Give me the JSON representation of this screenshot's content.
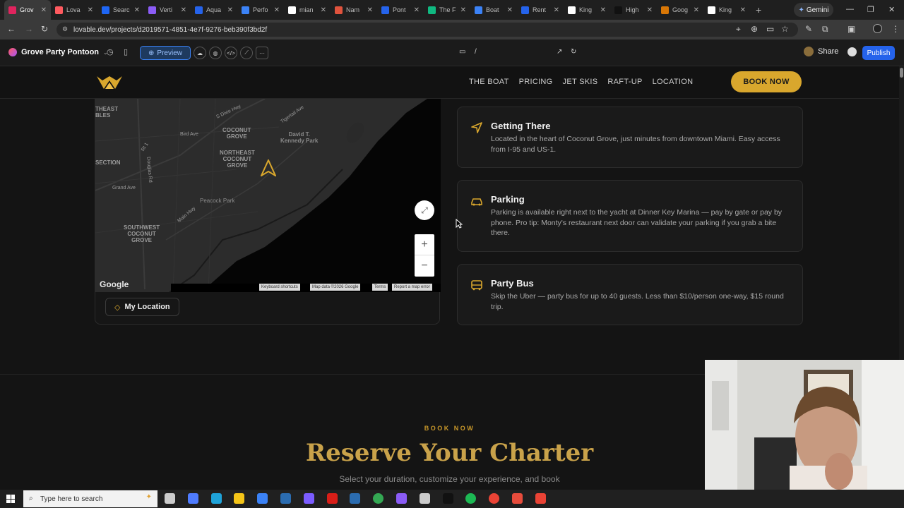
{
  "browser": {
    "tabs": [
      {
        "label": "Grov",
        "color": "#e0245e",
        "active": true
      },
      {
        "label": "Lova",
        "color": "#ff5a5f"
      },
      {
        "label": "Searc",
        "color": "#1e66f5"
      },
      {
        "label": "Verti",
        "color": "#8b5cf6"
      },
      {
        "label": "Aqua",
        "color": "#2563eb"
      },
      {
        "label": "Perfo",
        "color": "#3b82f6"
      },
      {
        "label": "mian",
        "color": "#ffffff"
      },
      {
        "label": "Nam",
        "color": "#e0533d"
      },
      {
        "label": "Pont",
        "color": "#2563eb"
      },
      {
        "label": "The F",
        "color": "#10b981"
      },
      {
        "label": "Boat",
        "color": "#3b82f6"
      },
      {
        "label": "Rent",
        "color": "#2563eb"
      },
      {
        "label": "King",
        "color": "#ffffff"
      },
      {
        "label": "High",
        "color": "#111111"
      },
      {
        "label": "Goog",
        "color": "#d97706"
      },
      {
        "label": "King",
        "color": "#ffffff"
      }
    ],
    "new_tab": "+",
    "gemini_label": "Gemini",
    "url": "lovable.dev/projects/d2019571-4851-4e7f-9276-beb390f3bd2f"
  },
  "lovable": {
    "project_name": "Grove Party Pontoon",
    "preview_label": "Preview",
    "route": "/",
    "share_label": "Share",
    "publish_label": "Publish"
  },
  "site": {
    "nav_links": [
      "THE BOAT",
      "PRICING",
      "JET SKIS",
      "RAFT-UP",
      "LOCATION"
    ],
    "book_now": "BOOK NOW",
    "map": {
      "labels": {
        "northeast": "THEAST\nBLES",
        "dixie": "S Dixie Hwy",
        "bird": "Bird Ave",
        "coconut_grove": "COCONUT\nGROVE",
        "ne_coconut": "NORTHEAST\nCOCONUT\nGROVE",
        "david": "David T.\nKennedy Park",
        "section": "SECTION",
        "grand": "Grand Ave",
        "peacock": "Peacock Park",
        "sw_coconut": "SOUTHWEST\nCOCONUT\nGROVE",
        "main_hwy": "Main Hwy",
        "tigertail": "Tigertail Ave",
        "douglas": "Douglas Rd",
        "rt": "Rt 1"
      },
      "google_logo": "Google",
      "footer": [
        "Keyboard shortcuts",
        "Map data ©2026 Google",
        "Terms",
        "Report a map error"
      ],
      "my_location": "My Location"
    },
    "cards": [
      {
        "icon": "navigation-icon",
        "title": "Getting There",
        "text": "Located in the heart of Coconut Grove, just minutes from downtown Miami. Easy access from I-95 and US-1."
      },
      {
        "icon": "car-icon",
        "title": "Parking",
        "text": "Parking is available right next to the yacht at Dinner Key Marina — pay by gate or pay by phone. Pro tip: Monty's restaurant next door can validate your parking if you grab a bite there."
      },
      {
        "icon": "bus-icon",
        "title": "Party Bus",
        "text": "Skip the Uber — party bus for up to 40 guests. Less than $10/person one-way, $15 round trip."
      }
    ],
    "booking": {
      "kicker": "BOOK NOW",
      "heading": "Reserve Your Charter",
      "subheading": "Select your duration, customize your experience, and book"
    }
  },
  "taskbar": {
    "search_placeholder": "Type here to search"
  },
  "colors": {
    "gold": "#d9a72d",
    "publish_blue": "#2563eb"
  }
}
